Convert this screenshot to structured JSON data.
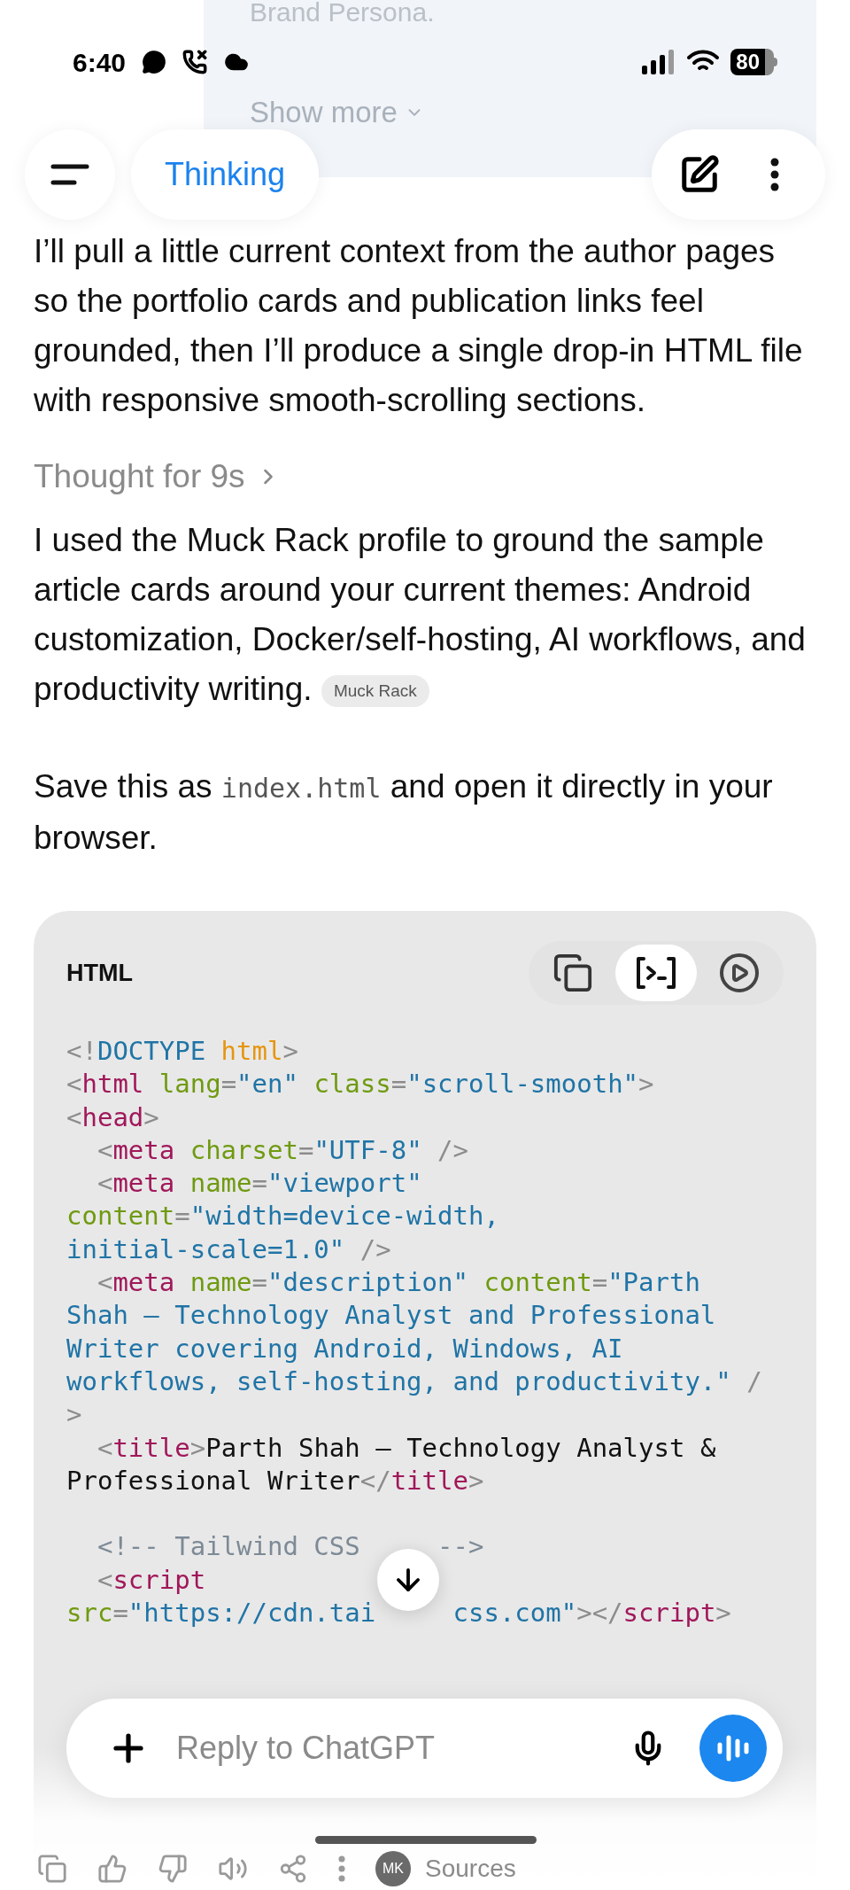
{
  "status_bar": {
    "time": "6:40",
    "battery": "80"
  },
  "background_card": {
    "text": "Brand Persona.",
    "show_more": "Show more"
  },
  "header": {
    "mode": "Thinking"
  },
  "messages": [
    {
      "kind": "paragraph",
      "text": "I’ll pull a little current context from the author pages so the portfolio cards and publication links feel grounded, then I’ll produce a single drop-in HTML file with responsive smooth-scrolling sections."
    },
    {
      "kind": "thought",
      "text": "Thought for 9s"
    },
    {
      "kind": "paragraph",
      "text": "I used the Muck Rack profile to ground the sample article cards around your current themes: Android customization, Docker/self-hosting, AI workflows, and productivity writing.",
      "chip": "Muck Rack"
    },
    {
      "kind": "segments",
      "segments": [
        {
          "kind": "text",
          "text": "Save this as "
        },
        {
          "kind": "code",
          "text": "index.html"
        },
        {
          "kind": "text",
          "text": " and open it directly in your browser."
        }
      ]
    }
  ],
  "code_block": {
    "language": "HTML",
    "tools": [
      {
        "kind": "copy",
        "selected": false
      },
      {
        "kind": "code",
        "selected": true
      },
      {
        "kind": "run",
        "selected": false
      }
    ],
    "groups": [
      [
        [
          [
            {
              "kind": "punct",
              "text": "<!"
            },
            {
              "kind": "string",
              "text": "DOCTYPE"
            },
            {
              "kind": "keyword",
              "text": " html"
            },
            {
              "kind": "punct",
              "text": ">"
            }
          ]
        ],
        [
          [
            {
              "kind": "punct",
              "text": "<"
            },
            {
              "kind": "tag",
              "text": "html"
            },
            {
              "kind": "attr",
              "text": " lang"
            },
            {
              "kind": "punct",
              "text": "="
            },
            {
              "kind": "string",
              "text": "\"en\""
            },
            {
              "kind": "attr",
              "text": " class"
            },
            {
              "kind": "punct",
              "text": "="
            },
            {
              "kind": "string",
              "text": "\"scroll-smooth\""
            },
            {
              "kind": "punct",
              "text": ">"
            }
          ]
        ],
        [
          [
            {
              "kind": "punct",
              "text": "<"
            },
            {
              "kind": "tag",
              "text": "head"
            },
            {
              "kind": "punct",
              "text": ">"
            }
          ]
        ],
        [
          [
            {
              "kind": "punct",
              "text": "  <"
            },
            {
              "kind": "tag",
              "text": "meta"
            },
            {
              "kind": "attr",
              "text": " charset"
            },
            {
              "kind": "punct",
              "text": "="
            },
            {
              "kind": "string",
              "text": "\"UTF-8\""
            },
            {
              "kind": "punct",
              "text": " />"
            }
          ]
        ],
        [
          [
            {
              "kind": "punct",
              "text": "  <"
            },
            {
              "kind": "tag",
              "text": "meta"
            },
            {
              "kind": "attr",
              "text": " name"
            },
            {
              "kind": "punct",
              "text": "="
            },
            {
              "kind": "string",
              "text": "\"viewport\""
            }
          ]
        ],
        [
          [
            {
              "kind": "attr",
              "text": "content"
            },
            {
              "kind": "punct",
              "text": "="
            },
            {
              "kind": "string",
              "text": "\"width=device-width,"
            }
          ]
        ],
        [
          [
            {
              "kind": "string",
              "text": "initial-scale=1.0\""
            },
            {
              "kind": "punct",
              "text": " />"
            }
          ]
        ],
        [
          [
            {
              "kind": "punct",
              "text": "  <"
            },
            {
              "kind": "tag",
              "text": "meta"
            },
            {
              "kind": "attr",
              "text": " name"
            },
            {
              "kind": "punct",
              "text": "="
            },
            {
              "kind": "string",
              "text": "\"description\""
            },
            {
              "kind": "attr",
              "text": " content"
            },
            {
              "kind": "punct",
              "text": "="
            },
            {
              "kind": "string",
              "text": "\"Parth"
            }
          ]
        ],
        [
          [
            {
              "kind": "string",
              "text": "Shah — Technology Analyst and Professional"
            }
          ]
        ],
        [
          [
            {
              "kind": "string",
              "text": "Writer covering Android, Windows, AI"
            }
          ]
        ],
        [
          [
            {
              "kind": "string",
              "text": "workflows, self-hosting, and productivity.\""
            },
            {
              "kind": "punct",
              "text": " /"
            }
          ]
        ],
        [
          [
            {
              "kind": "punct",
              "text": ">"
            }
          ]
        ],
        [
          [
            {
              "kind": "punct",
              "text": "  <"
            },
            {
              "kind": "tag",
              "text": "title"
            },
            {
              "kind": "punct",
              "text": ">"
            },
            {
              "kind": "plain",
              "text": "Parth Shah — Technology Analyst &"
            }
          ]
        ],
        [
          [
            {
              "kind": "plain",
              "text": "Professional Writer"
            },
            {
              "kind": "punct",
              "text": "</"
            },
            {
              "kind": "tag",
              "text": "title"
            },
            {
              "kind": "punct",
              "text": ">"
            }
          ]
        ]
      ],
      [
        [
          [
            {
              "kind": "comment",
              "text": "  <!-- Tailwind CSS"
            }
          ],
          [
            {
              "kind": "comment",
              "text": "-->"
            }
          ]
        ],
        [
          [
            {
              "kind": "punct",
              "text": "  <"
            },
            {
              "kind": "tag",
              "text": "script"
            }
          ]
        ],
        [
          [
            {
              "kind": "attr",
              "text": "src"
            },
            {
              "kind": "punct",
              "text": "="
            },
            {
              "kind": "string",
              "text": "\"https://cdn.tai"
            }
          ],
          [
            {
              "kind": "string",
              "text": "css.com\""
            },
            {
              "kind": "punct",
              "text": "></"
            },
            {
              "kind": "tag",
              "text": "script"
            },
            {
              "kind": "punct",
              "text": ">"
            }
          ]
        ]
      ]
    ]
  },
  "composer": {
    "placeholder": "Reply to ChatGPT"
  },
  "action_bar": {
    "avatar": "MK",
    "sources": "Sources"
  }
}
